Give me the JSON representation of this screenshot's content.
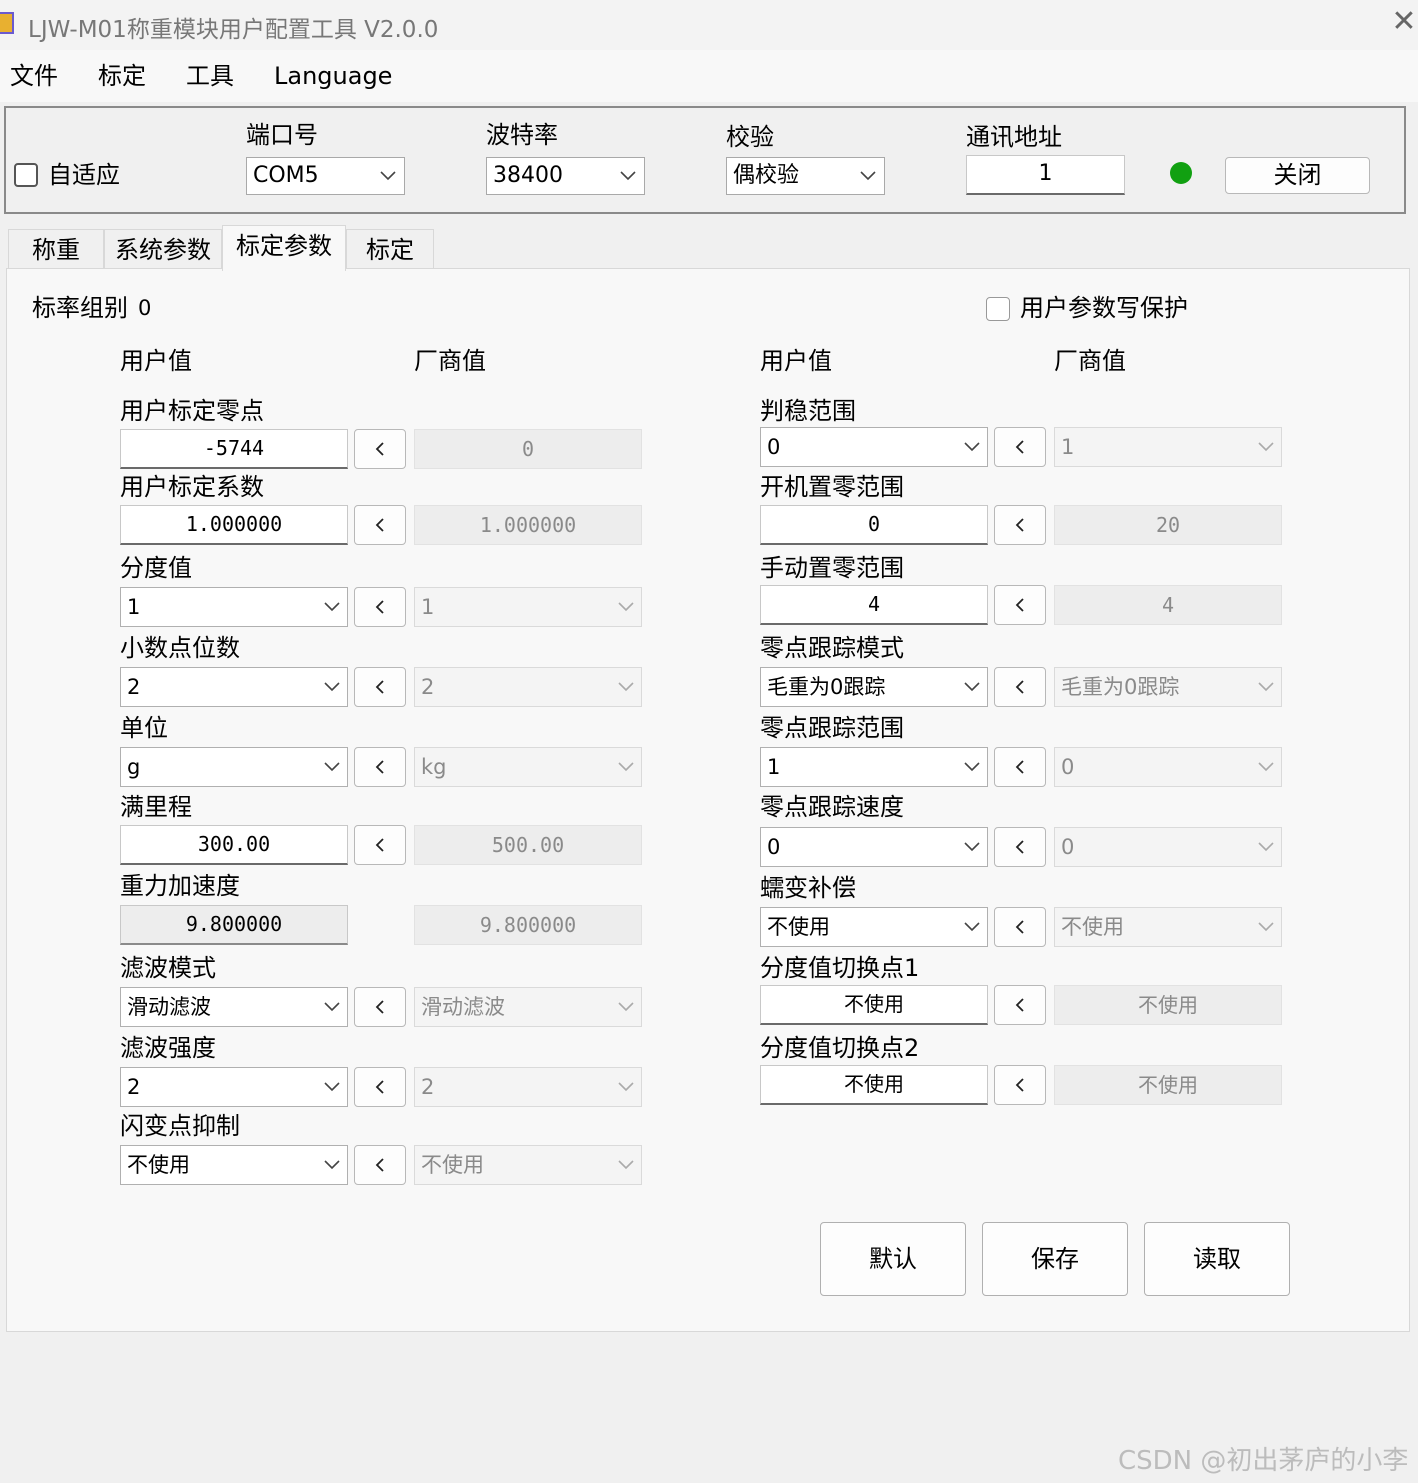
{
  "window": {
    "title": "LJW-M01称重模块用户配置工具 V2.0.0",
    "close_glyph": "✕"
  },
  "menu": {
    "items": [
      "文件",
      "标定",
      "工具",
      "Language"
    ]
  },
  "connection": {
    "auto_adapt_label": "自适应",
    "port_label": "端口号",
    "port_value": "COM5",
    "baud_label": "波特率",
    "baud_value": "38400",
    "parity_label": "校验",
    "parity_value": "偶校验",
    "address_label": "通讯地址",
    "address_value": "1",
    "status_color": "#11a011",
    "close_button": "关闭"
  },
  "tabs": [
    "称重",
    "系统参数",
    "标定参数",
    "标定"
  ],
  "active_tab": "标定参数",
  "panel": {
    "group_label": "标率组别",
    "group_value": "0",
    "write_protect_label": "用户参数写保护",
    "user_value_header": "用户值",
    "factory_value_header": "厂商值"
  },
  "left_params": [
    {
      "label": "用户标定零点",
      "user": "-5744",
      "factory": "0"
    },
    {
      "label": "用户标定系数",
      "user": "1.000000",
      "factory": "1.000000"
    },
    {
      "label": "分度值",
      "user": "1",
      "factory": "1"
    },
    {
      "label": "小数点位数",
      "user": "2",
      "factory": "2"
    },
    {
      "label": "单位",
      "user": "g",
      "factory": "kg"
    },
    {
      "label": "满里程",
      "user": "300.00",
      "factory": "500.00"
    },
    {
      "label": "重力加速度",
      "user": "9.800000",
      "factory": "9.800000"
    },
    {
      "label": "滤波模式",
      "user": "滑动滤波",
      "factory": "滑动滤波"
    },
    {
      "label": "滤波强度",
      "user": "2",
      "factory": "2"
    },
    {
      "label": "闪变点抑制",
      "user": "不使用",
      "factory": "不使用"
    }
  ],
  "right_params": [
    {
      "label": "判稳范围",
      "user": "0",
      "factory": "1"
    },
    {
      "label": "开机置零范围",
      "user": "0",
      "factory": "20"
    },
    {
      "label": "手动置零范围",
      "user": "4",
      "factory": "4"
    },
    {
      "label": "零点跟踪模式",
      "user": "毛重为0跟踪",
      "factory": "毛重为0跟踪"
    },
    {
      "label": "零点跟踪范围",
      "user": "1",
      "factory": "0"
    },
    {
      "label": "零点跟踪速度",
      "user": "0",
      "factory": "0"
    },
    {
      "label": "蠕变补偿",
      "user": "不使用",
      "factory": "不使用"
    },
    {
      "label": "分度值切换点1",
      "user": "不使用",
      "factory": "不使用"
    },
    {
      "label": "分度值切换点2",
      "user": "不使用",
      "factory": "不使用"
    }
  ],
  "actions": {
    "default": "默认",
    "save": "保存",
    "read": "读取"
  },
  "watermark": "CSDN @初出茅庐的小李"
}
